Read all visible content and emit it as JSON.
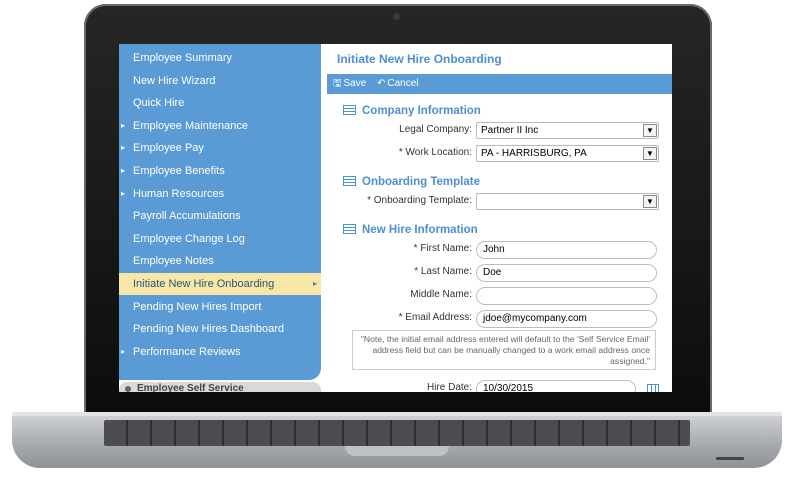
{
  "sidebar": {
    "items": [
      {
        "label": "Employee Summary",
        "expandable": false
      },
      {
        "label": "New Hire Wizard",
        "expandable": false
      },
      {
        "label": "Quick Hire",
        "expandable": false
      },
      {
        "label": "Employee Maintenance",
        "expandable": true
      },
      {
        "label": "Employee Pay",
        "expandable": true
      },
      {
        "label": "Employee Benefits",
        "expandable": true
      },
      {
        "label": "Human Resources",
        "expandable": true
      },
      {
        "label": "Payroll Accumulations",
        "expandable": false
      },
      {
        "label": "Employee Change Log",
        "expandable": false
      },
      {
        "label": "Employee Notes",
        "expandable": false
      },
      {
        "label": "Initiate New Hire Onboarding",
        "expandable": false,
        "active": true
      },
      {
        "label": "Pending New Hires Import",
        "expandable": false
      },
      {
        "label": "Pending New Hires Dashboard",
        "expandable": false
      },
      {
        "label": "Performance Reviews",
        "expandable": true
      }
    ],
    "footer_label": "Employee Self Service",
    "bullet_glyph": "▸",
    "active_arrow_glyph": "▸"
  },
  "page": {
    "title": "Initiate New Hire Onboarding"
  },
  "toolbar": {
    "save_label": "Save",
    "cancel_label": "Cancel",
    "save_icon": "floppy-disk-icon",
    "cancel_icon": "undo-icon"
  },
  "sections": {
    "company": "Company Information",
    "onboarding": "Onboarding Template",
    "newhire": "New Hire Information"
  },
  "fields": {
    "legal_company": {
      "label": "Legal Company:",
      "value": "Partner II Inc"
    },
    "work_location": {
      "label": "* Work Location:",
      "value": "PA - HARRISBURG, PA"
    },
    "onboarding_template": {
      "label": "* Onboarding Template:",
      "value": ""
    },
    "first_name": {
      "label": "* First Name:",
      "value": "John"
    },
    "last_name": {
      "label": "* Last Name:",
      "value": "Doe"
    },
    "middle_name": {
      "label": "Middle Name:",
      "value": ""
    },
    "email": {
      "label": "* Email Address:",
      "value": "jdoe@mycompany.com"
    },
    "hire_date": {
      "label": "Hire Date:",
      "value": "10/30/2015"
    }
  },
  "email_note": "\"Note, the initial email address entered will default to the 'Self Service Email' address field but can be manually changed to a work email address once assigned.\"",
  "colors": {
    "sidebar": "#5a9bd5",
    "active_item": "#f7e7a6",
    "heading": "#4f8ed0"
  }
}
